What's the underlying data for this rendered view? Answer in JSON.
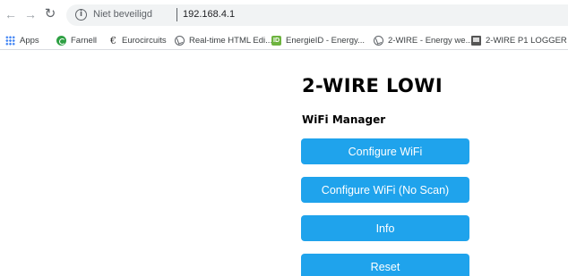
{
  "browser": {
    "security_label": "Niet beveiligd",
    "url": "192.168.4.1",
    "icons": {
      "back": "arrow-left-icon",
      "forward": "arrow-right-icon",
      "reload": "reload-icon",
      "info": "info-icon"
    }
  },
  "bookmarks": [
    {
      "label": "Apps",
      "icon": "apps-grid-icon"
    },
    {
      "label": "Farnell",
      "icon": "farnell-icon"
    },
    {
      "label": "Eurocircuits",
      "icon": "eurocircuits-icon"
    },
    {
      "label": "Real-time HTML Edi...",
      "icon": "globe-icon"
    },
    {
      "label": "EnergieID - Energy...",
      "icon": "energieid-icon"
    },
    {
      "label": "2-WIRE - Energy we...",
      "icon": "globe-icon"
    },
    {
      "label": "2-WIRE P1 LOGGER",
      "icon": "logger-icon"
    }
  ],
  "page": {
    "title": "2-WIRE LOWI",
    "subtitle": "WiFi Manager",
    "buttons": [
      {
        "label": "Configure WiFi"
      },
      {
        "label": "Configure WiFi (No Scan)"
      },
      {
        "label": "Info"
      },
      {
        "label": "Reset"
      }
    ]
  },
  "colors": {
    "button_bg": "#1fa3ec",
    "button_text": "#ffffff",
    "omnibox_bg": "#f1f3f4"
  }
}
